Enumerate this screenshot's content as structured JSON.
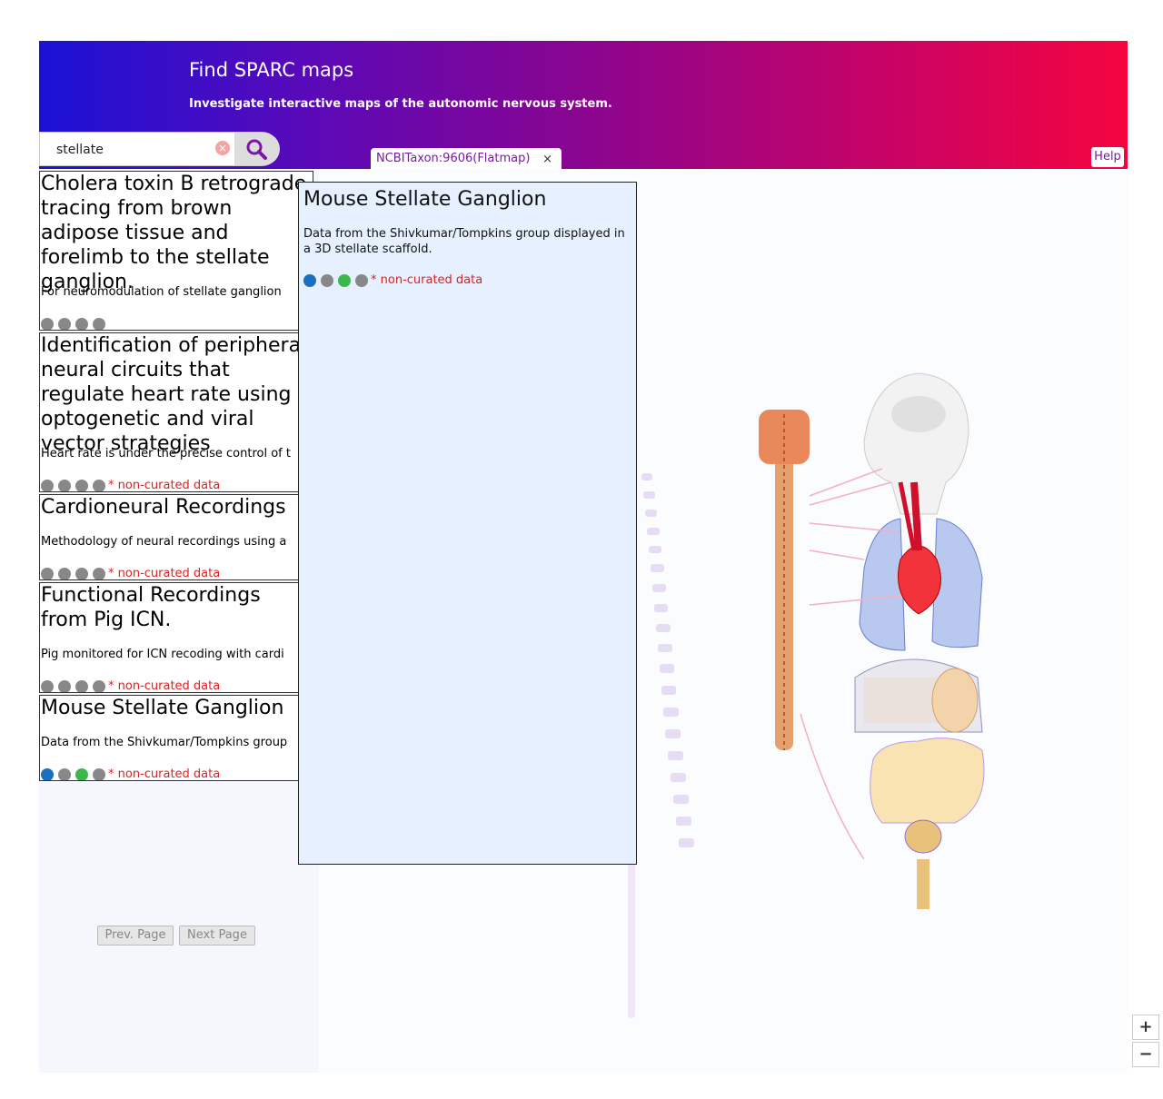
{
  "header": {
    "title": "Find SPARC maps",
    "subtitle": "Investigate interactive maps of the autonomic nervous system."
  },
  "search": {
    "value": "stellate",
    "placeholder": ""
  },
  "map_tab": {
    "label": "NCBITaxon:9606(Flatmap)",
    "close": "×"
  },
  "help_label": "Help",
  "noncurated_label": "* non-curated data",
  "results": [
    {
      "title": "Cholera toxin B retrograde tracing from brown adipose tissue and forelimb to the stellate ganglion.",
      "description": "For neuromodulation of stellate ganglion",
      "dots": [
        "#888888",
        "#888888",
        "#888888",
        "#888888"
      ],
      "noncurated": false
    },
    {
      "title": "Identification of peripheral neural circuits that regulate heart rate using optogenetic and viral vector strategies",
      "description": "Heart rate is under the precise control of t",
      "dots": [
        "#888888",
        "#888888",
        "#888888",
        "#888888"
      ],
      "noncurated": true
    },
    {
      "title": "Cardioneural Recordings",
      "description": "Methodology of neural recordings using a",
      "dots": [
        "#888888",
        "#888888",
        "#888888",
        "#888888"
      ],
      "noncurated": true
    },
    {
      "title": "Functional Recordings from Pig ICN.",
      "description": "Pig monitored for ICN recoding with cardi",
      "dots": [
        "#888888",
        "#888888",
        "#888888",
        "#888888"
      ],
      "noncurated": true
    },
    {
      "title": "Mouse Stellate Ganglion",
      "description": "Data from the Shivkumar/Tompkins group",
      "dots": [
        "#1a6fc0",
        "#888888",
        "#3cb84a",
        "#888888"
      ],
      "noncurated": true
    }
  ],
  "pagination": {
    "prev": "Prev. Page",
    "next": "Next Page"
  },
  "popup": {
    "title": "Mouse Stellate Ganglion",
    "description": "Data from the Shivkumar/Tompkins group displayed in a 3D stellate scaffold.",
    "dots": [
      "#1a6fc0",
      "#888888",
      "#3cb84a",
      "#888888"
    ]
  },
  "zoom": {
    "in": "+",
    "out": "−"
  },
  "colors": {
    "accent": "#7c16a8",
    "warning": "#e02020",
    "arrow": "#c00000"
  }
}
